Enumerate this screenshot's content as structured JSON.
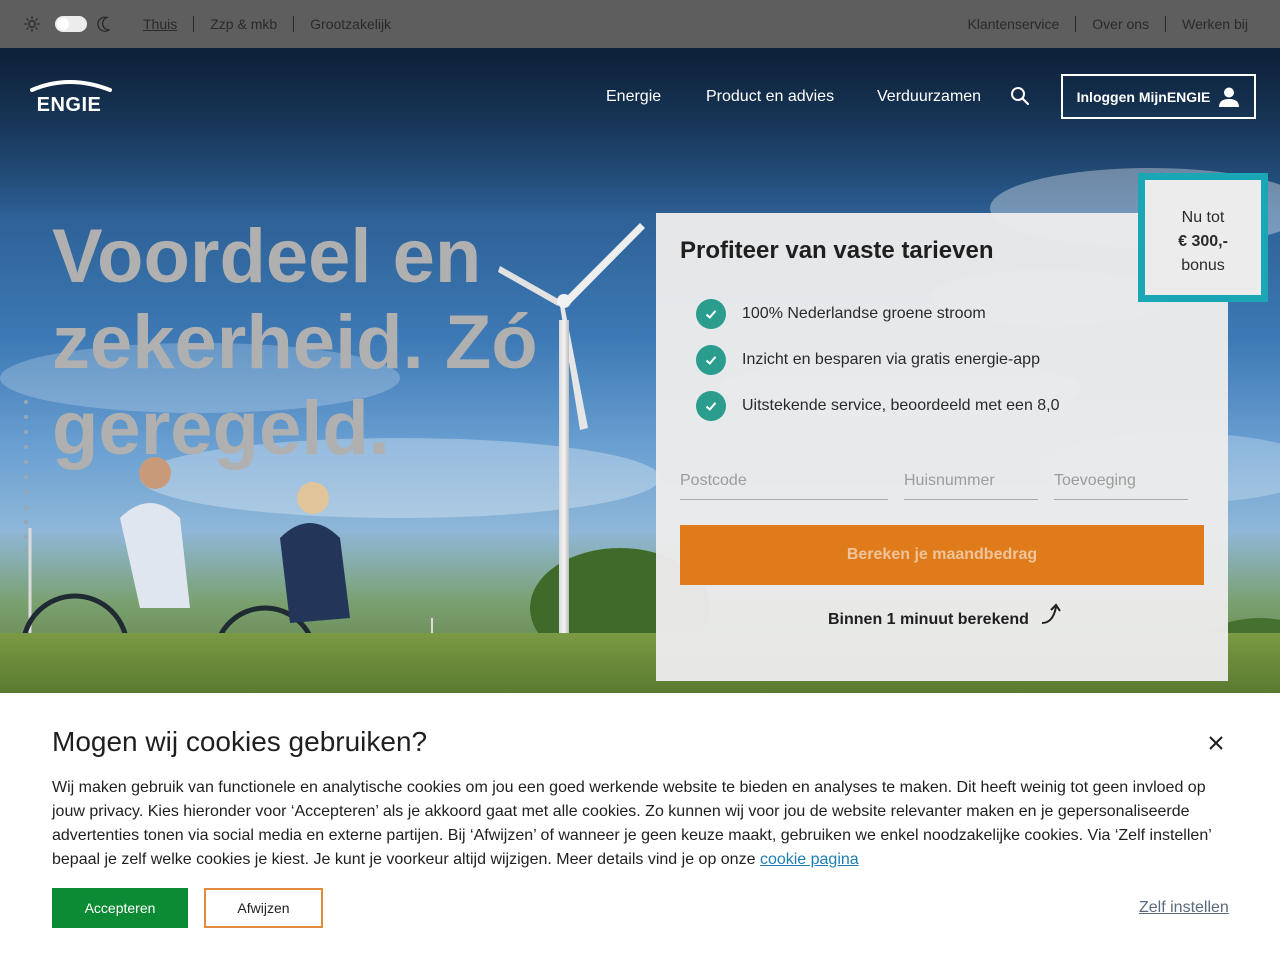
{
  "topbar": {
    "segments": [
      "Thuis",
      "Zzp & mkb",
      "Grootzakelijk"
    ],
    "utility_links": [
      "Klantenservice",
      "Over ons",
      "Werken bij"
    ]
  },
  "header": {
    "logo_text": "ENGIE",
    "nav": [
      "Energie",
      "Product en advies",
      "Verduurzamen"
    ],
    "login_label": "Inloggen MijnENGIE"
  },
  "hero": {
    "headline": [
      "Voordeel en",
      "zekerheid. Zó",
      "geregeld."
    ]
  },
  "calculator": {
    "title": "Profiteer van vaste tarieven",
    "usps": [
      "100% Nederlandse groene stroom",
      "Inzicht en besparen via gratis energie-app",
      "Uitstekende service, beoordeeld met een 8,0"
    ],
    "postcode_placeholder": "Postcode",
    "huisnummer_placeholder": "Huisnummer",
    "toevoeging_placeholder": "Toevoeging",
    "cta_label": "Bereken je maandbedrag",
    "subtext": "Binnen 1 minuut berekend"
  },
  "bonus": {
    "line1": "Nu tot",
    "amount": "€ 300,-",
    "line3": "bonus"
  },
  "cookie": {
    "title": "Mogen wij cookies gebruiken?",
    "body": "Wij maken gebruik van functionele en analytische cookies om jou een goed werkende website te bieden en analyses te maken. Dit heeft weinig tot geen invloed op jouw privacy. Kies hieronder voor ‘Accepteren’ als je akkoord gaat met alle cookies. Zo kunnen wij voor jou de website relevanter maken en je gepersonaliseerde advertenties tonen via social media en externe partijen. Bij ‘Afwijzen’ of wanneer je geen keuze maakt, gebruiken we enkel noodzakelijke cookies. Via ‘Zelf instellen’ bepaal je zelf welke cookies je kiest. Je kunt je voorkeur altijd wijzigen. Meer details vind je op onze",
    "link_label": "cookie pagina",
    "accept_label": "Accepteren",
    "decline_label": "Afwijzen",
    "settings_label": "Zelf instellen"
  },
  "colors": {
    "accent_orange": "#e07b1c",
    "accept_green": "#0c8a34",
    "check_teal": "#2a9d8f",
    "bonus_border": "#1aa6b5"
  },
  "icons": [
    "sun-icon",
    "moon-icon",
    "search-icon",
    "person-icon",
    "check-icon",
    "arrow-up-icon",
    "close-icon"
  ]
}
